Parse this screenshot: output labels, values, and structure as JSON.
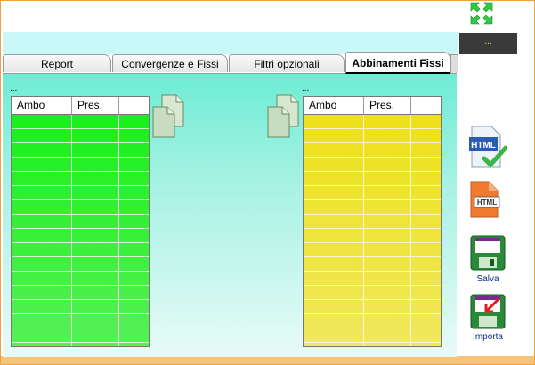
{
  "topbar": {
    "dark_box_text": "..."
  },
  "tabs": [
    {
      "label": "Report"
    },
    {
      "label": "Convergenze e Fissi"
    },
    {
      "label": "Filtri opzionali"
    },
    {
      "label": "Abbinamenti Fissi"
    }
  ],
  "active_tab": "Abbinamenti Fissi",
  "left_table": {
    "caption": "...",
    "columns": [
      "Ambo",
      "Pres.",
      ""
    ],
    "color": "#22f022"
  },
  "right_table": {
    "caption": "...",
    "columns": [
      "Ambo",
      "Pres.",
      ""
    ],
    "color": "#f0e030"
  },
  "sidebar": {
    "html_check_icon_text": "HTML",
    "html_file_icon_text": "HTML",
    "salva_label": "Salva",
    "importa_label": "Importa"
  },
  "icons": [
    "expand-icon",
    "copy-icon",
    "html-check-icon",
    "html-file-icon",
    "save-icon",
    "import-icon"
  ]
}
